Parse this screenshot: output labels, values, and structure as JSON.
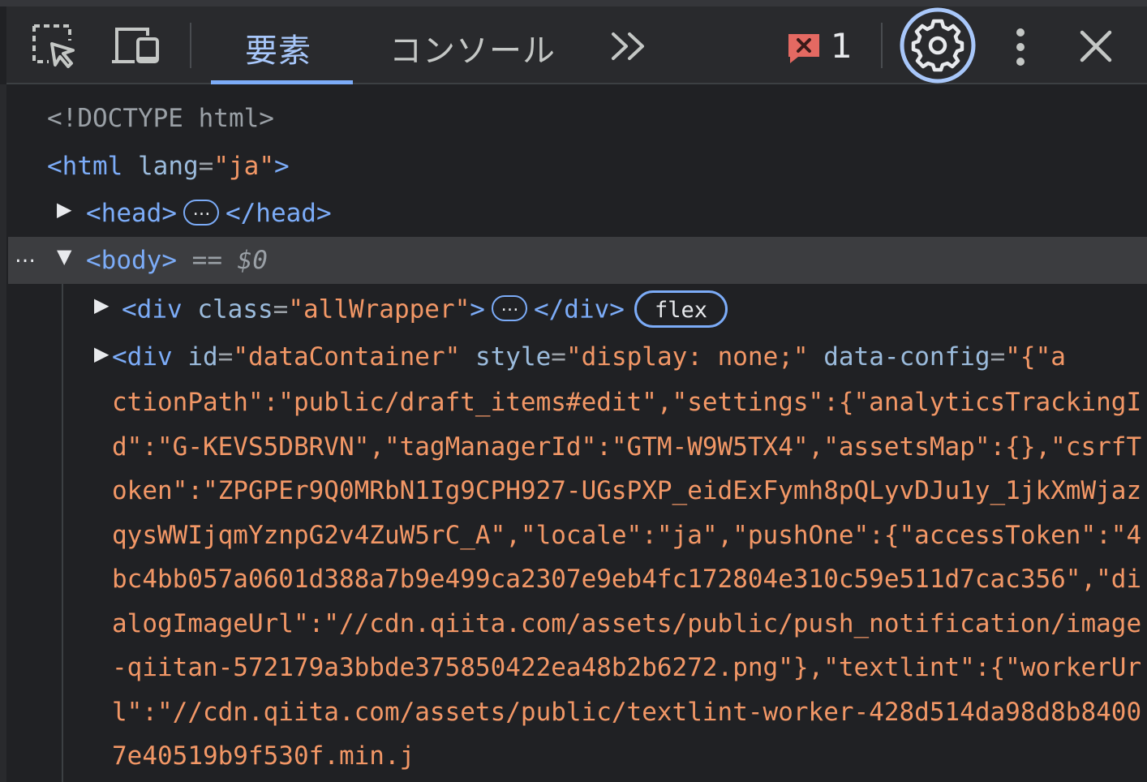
{
  "toolbar": {
    "tabs": [
      {
        "label": "要素",
        "active": true
      },
      {
        "label": "コンソール",
        "active": false
      }
    ],
    "more_tabs_label": "»",
    "error_count": "1",
    "icons": [
      "inspect-element-icon",
      "device-toolbar-icon",
      "more-tabs-icon",
      "error-badge-icon",
      "settings-gear-icon",
      "kebab-menu-icon",
      "close-icon"
    ]
  },
  "dom_tree": {
    "doctype": "<!DOCTYPE html>",
    "html_open": {
      "tag": "html",
      "attr_name": "lang",
      "attr_value": "\"ja\""
    },
    "head": {
      "open": "<head>",
      "close": "</head>",
      "ellipsis": "…"
    },
    "body": {
      "open": "<body>",
      "selection_marker": "== $0",
      "row_dots": "…"
    },
    "div_wrapper": {
      "open_tag": "<div",
      "attr_name": "class",
      "attr_value": "\"allWrapper\"",
      "close": "</div>",
      "badge": "flex"
    },
    "div_data": {
      "open_tag": "<div",
      "attr1_name": "id",
      "attr1_value": "\"dataContainer\"",
      "attr2_name": "style",
      "attr2_value": "\"display: none;\"",
      "attr3_name": "data-config",
      "attr3_value_start": "\"{\"a",
      "wrapped_value": "ctionPath\":\"public/draft_items#edit\",\"settings\":{\"analyticsTrackingId\":\"G-KEVS5DBRVN\",\"tagManagerId\":\"GTM-W9W5TX4\",\"assetsMap\":{},\"csrfToken\":\"ZPGPEr9Q0MRbN1Ig9CPH927-UGsPXP_eidExFymh8pQLyvDJu1y_1jkXmWjazqysWWIjqmYznpG2v4ZuW5rC_A\",\"locale\":\"ja\",\"pushOne\":{\"accessToken\":\"4bc4bb057a0601d388a7b9e499ca2307e9eb4fc172804e310c59e511d7cac356\",\"dialogImageUrl\":\"//cdn.qiita.com/assets/public/push_notification/image-qiitan-572179a3bbde375850422ea48b2b6272.png\"},\"textlint\":{\"workerUrl\":\"//cdn.qiita.com/assets/public/textlint-worker-428d514da98d8b84007e40519b9f530f.min.j"
    }
  },
  "colors": {
    "background": "#202124",
    "toolbar": "#292a2d",
    "accent": "#7cacf8",
    "tag": "#7cacf8",
    "attribute": "#9bbbdc",
    "value": "#f29766",
    "error": "#e46962",
    "selected_row": "#3c3d40"
  }
}
